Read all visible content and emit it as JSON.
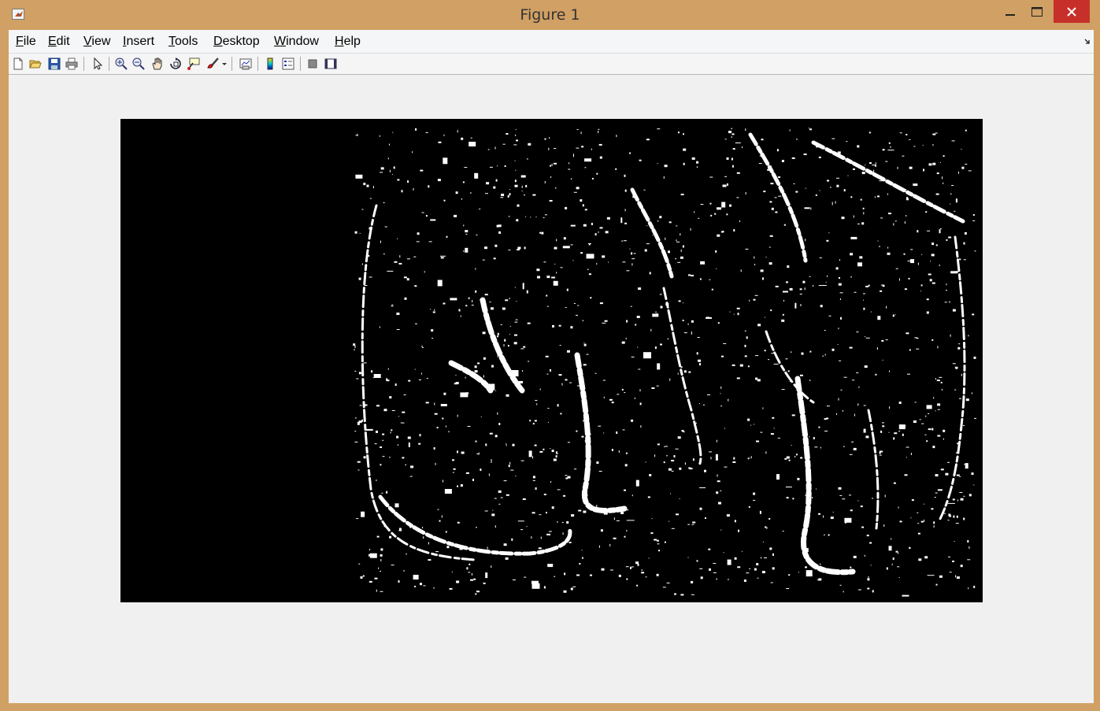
{
  "window": {
    "title": "Figure 1"
  },
  "menu": [
    {
      "label": "File",
      "mnemonic": "F",
      "rest": "ile"
    },
    {
      "label": "Edit",
      "mnemonic": "E",
      "rest": "dit"
    },
    {
      "label": "View",
      "mnemonic": "V",
      "rest": "iew"
    },
    {
      "label": "Insert",
      "mnemonic": "I",
      "rest": "nsert"
    },
    {
      "label": "Tools",
      "mnemonic": "T",
      "rest": "ools"
    },
    {
      "label": "Desktop",
      "mnemonic": "D",
      "rest": "esktop"
    },
    {
      "label": "Window",
      "mnemonic": "W",
      "rest": "indow"
    },
    {
      "label": "Help",
      "mnemonic": "H",
      "rest": "elp"
    }
  ],
  "toolbar": [
    "new-figure-icon",
    "open-file-icon",
    "save-figure-icon",
    "print-figure-icon",
    "edit-plot-icon",
    "zoom-in-icon",
    "zoom-out-icon",
    "pan-icon",
    "rotate-3d-icon",
    "data-cursor-icon",
    "brush-icon",
    "link-plot-icon",
    "insert-colorbar-icon",
    "insert-legend-icon",
    "hide-plot-tools-icon",
    "show-plot-tools-icon"
  ],
  "colors": {
    "frame": "#d1a064",
    "close_button": "#c7302a",
    "image_background": "#000000",
    "image_foreground": "#ffffff"
  }
}
